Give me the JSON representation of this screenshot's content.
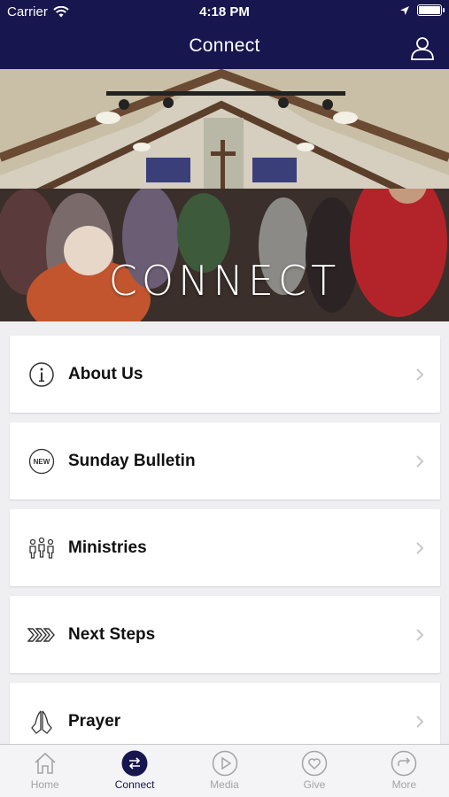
{
  "status_bar": {
    "carrier": "Carrier",
    "time": "4:18 PM"
  },
  "nav": {
    "title": "Connect"
  },
  "hero": {
    "title": "CONNECT"
  },
  "menu": [
    {
      "label": "About Us",
      "icon": "info-icon"
    },
    {
      "label": "Sunday Bulletin",
      "icon": "new-badge-icon",
      "icon_text": "NEW"
    },
    {
      "label": "Ministries",
      "icon": "people-icon"
    },
    {
      "label": "Next Steps",
      "icon": "chevrons-right-icon"
    },
    {
      "label": "Prayer",
      "icon": "praying-hands-icon"
    }
  ],
  "tabs": [
    {
      "label": "Home",
      "icon": "home-icon",
      "active": false
    },
    {
      "label": "Connect",
      "icon": "exchange-icon",
      "active": true
    },
    {
      "label": "Media",
      "icon": "play-icon",
      "active": false
    },
    {
      "label": "Give",
      "icon": "heart-icon",
      "active": false
    },
    {
      "label": "More",
      "icon": "more-arrow-icon",
      "active": false
    }
  ],
  "colors": {
    "nav_bg": "#17164e",
    "active_tab": "#17164e",
    "inactive_tab": "#a3a3a8",
    "page_bg": "#efeff1"
  }
}
